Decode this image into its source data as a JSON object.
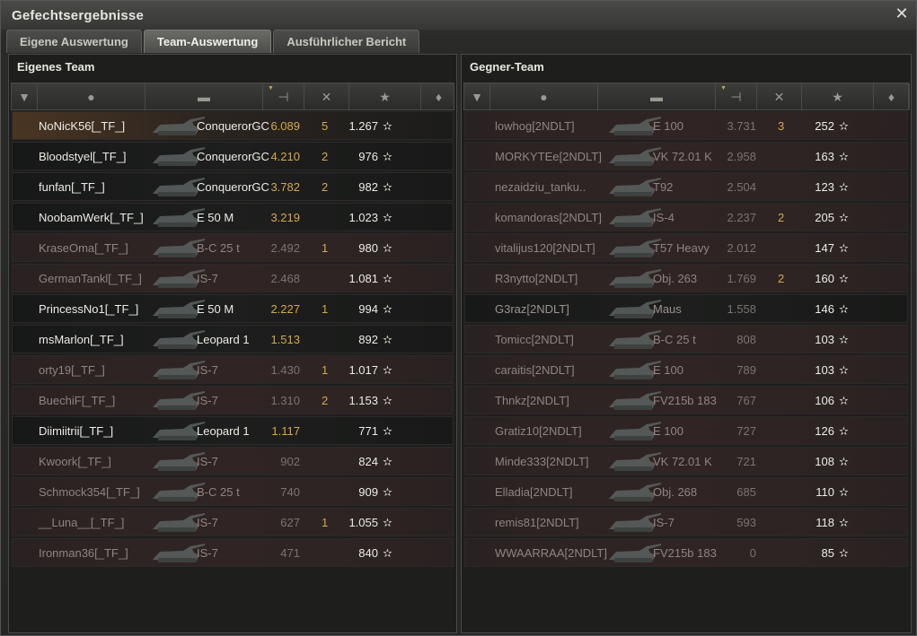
{
  "window": {
    "title": "Gefechtsergebnisse",
    "close_icon": "close-icon"
  },
  "tabs": [
    {
      "label": "Eigene Auswertung",
      "active": false
    },
    {
      "label": "Team-Auswertung",
      "active": true
    },
    {
      "label": "Ausführlicher Bericht",
      "active": false
    }
  ],
  "columns": [
    "squad-icon",
    "player-icon",
    "tank-icon",
    "damage-icon",
    "kills-icon",
    "xp-star-icon",
    "medal-icon"
  ],
  "own_team": {
    "title": "Eigenes Team",
    "rows": [
      {
        "name": "NoNicK56[_TF_]",
        "tank": "ConquerorGC",
        "damage": "6.089",
        "kills": "5",
        "xp": "1.267",
        "state": "me"
      },
      {
        "name": "Bloodstyel[_TF_]",
        "tank": "ConquerorGC",
        "damage": "4.210",
        "kills": "2",
        "xp": "976",
        "state": "alive"
      },
      {
        "name": "funfan[_TF_]",
        "tank": "ConquerorGC",
        "damage": "3.782",
        "kills": "2",
        "xp": "982",
        "state": "alive"
      },
      {
        "name": "NoobamWerk[_TF_]",
        "tank": "E 50 M",
        "damage": "3.219",
        "kills": "",
        "xp": "1.023",
        "state": "alive"
      },
      {
        "name": "KraseOma[_TF_]",
        "tank": "B-C 25 t",
        "damage": "2.492",
        "kills": "1",
        "xp": "980",
        "state": "dead"
      },
      {
        "name": "GermanTankl[_TF_]",
        "tank": "IS-7",
        "damage": "2.468",
        "kills": "",
        "xp": "1.081",
        "state": "dead"
      },
      {
        "name": "PrincessNo1[_TF_]",
        "tank": "E 50 M",
        "damage": "2.227",
        "kills": "1",
        "xp": "994",
        "state": "alive"
      },
      {
        "name": "msMarlon[_TF_]",
        "tank": "Leopard 1",
        "damage": "1.513",
        "kills": "",
        "xp": "892",
        "state": "alive"
      },
      {
        "name": "orty19[_TF_]",
        "tank": "IS-7",
        "damage": "1.430",
        "kills": "1",
        "xp": "1.017",
        "state": "dead"
      },
      {
        "name": "BuechiF[_TF_]",
        "tank": "IS-7",
        "damage": "1.310",
        "kills": "2",
        "xp": "1.153",
        "state": "dead"
      },
      {
        "name": "Diimiitrii[_TF_]",
        "tank": "Leopard 1",
        "damage": "1.117",
        "kills": "",
        "xp": "771",
        "state": "alive"
      },
      {
        "name": "Kwoork[_TF_]",
        "tank": "IS-7",
        "damage": "902",
        "kills": "",
        "xp": "824",
        "state": "dead"
      },
      {
        "name": "Schmock354[_TF_]",
        "tank": "B-C 25 t",
        "damage": "740",
        "kills": "",
        "xp": "909",
        "state": "dead"
      },
      {
        "name": "__Luna__[_TF_]",
        "tank": "IS-7",
        "damage": "627",
        "kills": "1",
        "xp": "1.055",
        "state": "dead"
      },
      {
        "name": "Ironman36[_TF_]",
        "tank": "IS-7",
        "damage": "471",
        "kills": "",
        "xp": "840",
        "state": "dead"
      }
    ]
  },
  "enemy_team": {
    "title": "Gegner-Team",
    "rows": [
      {
        "name": "lowhog[2NDLT]",
        "tank": "E 100",
        "damage": "3.731",
        "kills": "3",
        "xp": "252",
        "state": "dead"
      },
      {
        "name": "MORKYTEe[2NDLT]",
        "tank": "VK 72.01 K",
        "damage": "2.958",
        "kills": "",
        "xp": "163",
        "state": "dead"
      },
      {
        "name": "nezaidziu_tanku..",
        "tank": "T92",
        "damage": "2.504",
        "kills": "",
        "xp": "123",
        "state": "dead"
      },
      {
        "name": "komandoras[2NDLT]",
        "tank": "IS-4",
        "damage": "2.237",
        "kills": "2",
        "xp": "205",
        "state": "dead"
      },
      {
        "name": "vitalijus120[2NDLT]",
        "tank": "T57 Heavy",
        "damage": "2.012",
        "kills": "",
        "xp": "147",
        "state": "dead"
      },
      {
        "name": "R3nytto[2NDLT]",
        "tank": "Obj. 263",
        "damage": "1.769",
        "kills": "2",
        "xp": "160",
        "state": "dead"
      },
      {
        "name": "G3raz[2NDLT]",
        "tank": "Maus",
        "damage": "1.558",
        "kills": "",
        "xp": "146",
        "state": "alive"
      },
      {
        "name": "Tomicc[2NDLT]",
        "tank": "B-C 25 t",
        "damage": "808",
        "kills": "",
        "xp": "103",
        "state": "dead"
      },
      {
        "name": "caraitis[2NDLT]",
        "tank": "E 100",
        "damage": "789",
        "kills": "",
        "xp": "103",
        "state": "dead"
      },
      {
        "name": "Thnkz[2NDLT]",
        "tank": "FV215b 183",
        "damage": "767",
        "kills": "",
        "xp": "106",
        "state": "dead"
      },
      {
        "name": "Gratiz10[2NDLT]",
        "tank": "E 100",
        "damage": "727",
        "kills": "",
        "xp": "126",
        "state": "dead"
      },
      {
        "name": "Minde333[2NDLT]",
        "tank": "VK 72.01 K",
        "damage": "721",
        "kills": "",
        "xp": "108",
        "state": "dead"
      },
      {
        "name": "Elladia[2NDLT]",
        "tank": "Obj. 268",
        "damage": "685",
        "kills": "",
        "xp": "110",
        "state": "dead"
      },
      {
        "name": "remis81[2NDLT]",
        "tank": "IS-7",
        "damage": "593",
        "kills": "",
        "xp": "118",
        "state": "dead"
      },
      {
        "name": "WWAARRAA[2NDLT]",
        "tank": "FV215b 183",
        "damage": "0",
        "kills": "",
        "xp": "85",
        "state": "dead"
      }
    ]
  },
  "star_glyph": "✫"
}
